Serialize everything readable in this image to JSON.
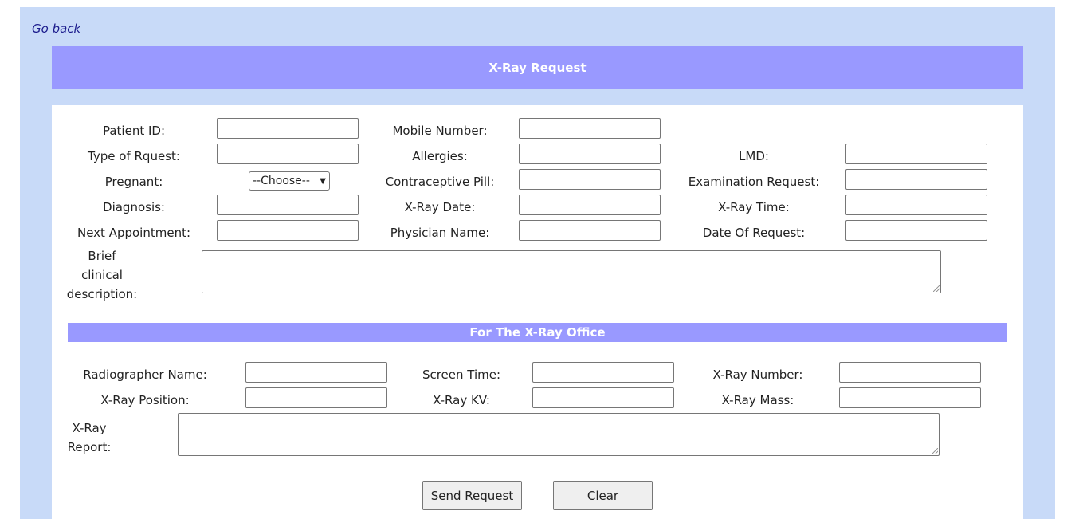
{
  "nav": {
    "go_back": "Go back"
  },
  "header": {
    "title": "X-Ray Request"
  },
  "request_form": {
    "patient_id": "Patient ID:",
    "mobile_number": "Mobile Number:",
    "type_of_request": "Type of Rquest:",
    "allergies": "Allergies:",
    "lmd": "LMD:",
    "pregnant": "Pregnant:",
    "pregnant_select": "--Choose--",
    "contraceptive_pill": "Contraceptive Pill:",
    "examination_request": "Examination Request:",
    "diagnosis": "Diagnosis:",
    "xray_date": "X-Ray Date:",
    "xray_time": "X-Ray Time:",
    "next_appointment": "Next Appointment:",
    "physician_name": "Physician Name:",
    "date_of_request": "Date Of Request:",
    "brief_line1": "Brief",
    "brief_line2": "clinical",
    "brief_line3": "description:"
  },
  "office": {
    "title": "For The X-Ray Office",
    "radiographer_name": "Radiographer Name:",
    "screen_time": "Screen Time:",
    "xray_number": "X-Ray Number:",
    "xray_position": "X-Ray Position:",
    "xray_kv": "X-Ray KV:",
    "xray_mass": "X-Ray Mass:",
    "report_line1": "X-Ray",
    "report_line2": "Report:"
  },
  "actions": {
    "send": "Send Request",
    "clear": "Clear"
  }
}
